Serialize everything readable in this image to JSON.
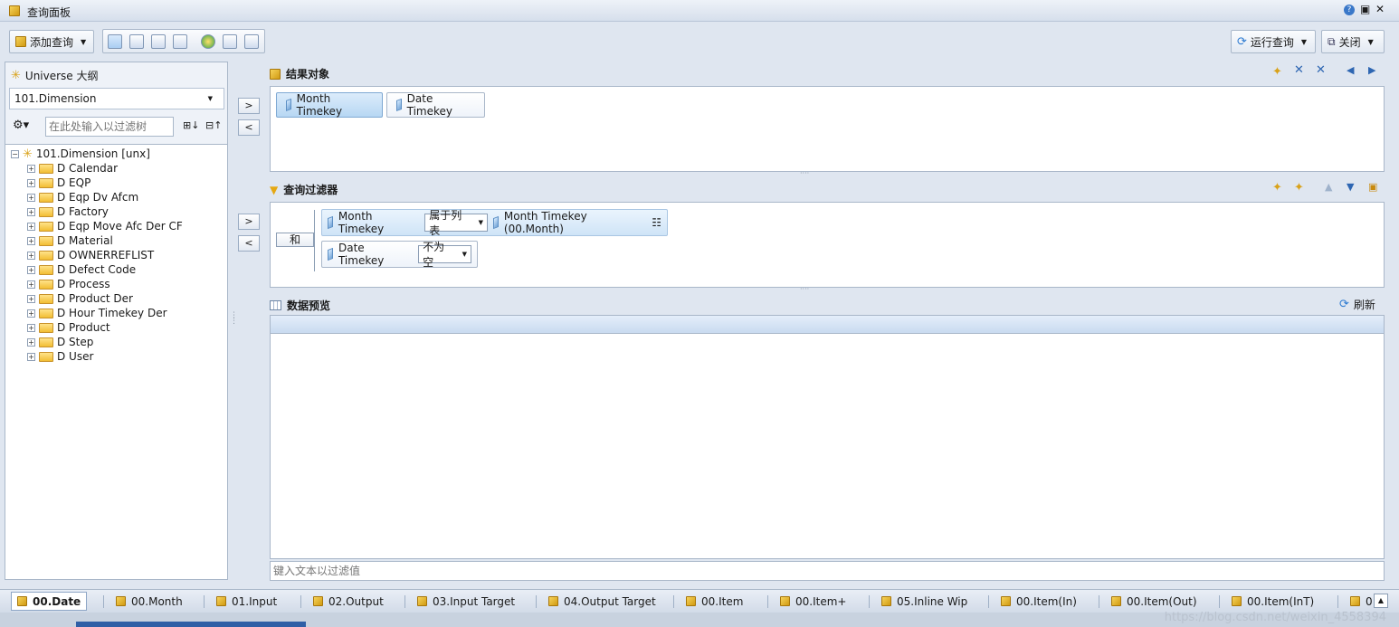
{
  "window": {
    "title": "查询面板",
    "controls": [
      "?",
      "▣",
      "✕"
    ]
  },
  "toolbar": {
    "add_query": "添加查询",
    "run_query": "运行查询",
    "close": "关闭"
  },
  "outline": {
    "title": "Universe 大纲",
    "universe_select": "101.Dimension",
    "filter_placeholder": "在此处输入以过滤树",
    "root": "101.Dimension [unx]",
    "items": [
      "D Calendar",
      "D EQP",
      "D Eqp Dv Afcm",
      "D Factory",
      "D Eqp Move Afc Der CF",
      "D Material",
      "D OWNERREFLIST",
      "D Defect Code",
      "D Process",
      "D Product Der",
      "D Hour Timekey Der",
      "D Product",
      "D Step",
      "D User"
    ]
  },
  "result_objects": {
    "title": "结果对象",
    "objects": [
      "Month Timekey",
      "Date Timekey"
    ]
  },
  "query_filters": {
    "title": "查询过滤器",
    "operator": "和",
    "conditions": [
      {
        "object": "Month Timekey",
        "operator": "属于列表",
        "value": "Month Timekey (00.Month)"
      },
      {
        "object": "Date Timekey",
        "operator": "不为空",
        "value": ""
      }
    ]
  },
  "data_preview": {
    "title": "数据预览",
    "refresh": "刷新",
    "filter_placeholder": "键入文本以过滤值"
  },
  "move_buttons": {
    "add": ">",
    "remove": "<"
  },
  "tabs": [
    "00.Date",
    "00.Month",
    "01.Input",
    "02.Output",
    "03.Input Target",
    "04.Output Target",
    "00.Item",
    "00.Item+",
    "05.Inline Wip",
    "00.Item(In)",
    "00.Item(Out)",
    "00.Item(InT)",
    "0"
  ],
  "active_tab": "00.Date",
  "watermark": "https://blog.csdn.net/weixin_4558394"
}
